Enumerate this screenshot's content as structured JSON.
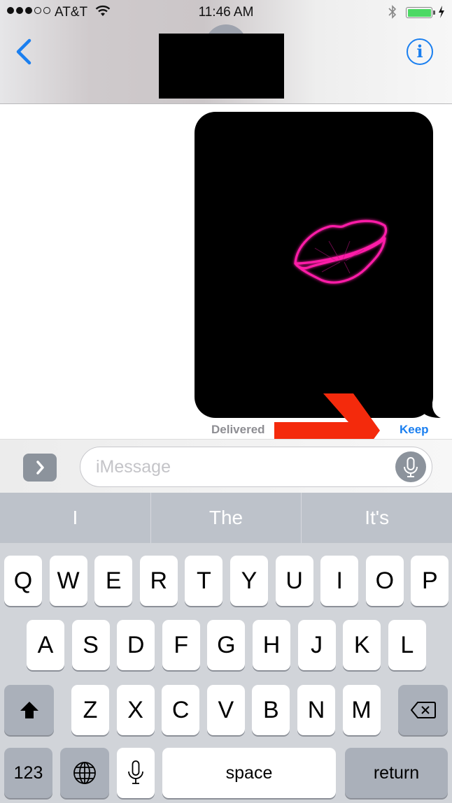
{
  "status_bar": {
    "signal_bars_filled": 3,
    "signal_bars_total": 5,
    "carrier": "AT&T",
    "time": "11:46 AM",
    "battery_level": 1.0,
    "charging": true,
    "icons": [
      "wifi-icon",
      "bluetooth-icon",
      "battery-icon",
      "charging-bolt-icon"
    ]
  },
  "nav": {
    "back_icon": "chevron-left-icon",
    "contact_name_redacted": true,
    "info_label": "i"
  },
  "conversation": {
    "message": {
      "type": "digital-touch-kiss",
      "content_icon": "kiss-lips-icon"
    },
    "delivered_label": "Delivered",
    "keep_label": "Keep",
    "annotation": "red-arrow-pointing-to-keep"
  },
  "input_bar": {
    "expand_icon": "chevron-right-icon",
    "placeholder": "iMessage",
    "value": "",
    "mic_icon": "microphone-icon"
  },
  "keyboard": {
    "predictions": [
      "I",
      "The",
      "It's"
    ],
    "row1": [
      "Q",
      "W",
      "E",
      "R",
      "T",
      "Y",
      "U",
      "I",
      "O",
      "P"
    ],
    "row2": [
      "A",
      "S",
      "D",
      "F",
      "G",
      "H",
      "J",
      "K",
      "L"
    ],
    "row3": [
      "Z",
      "X",
      "C",
      "V",
      "B",
      "N",
      "M"
    ],
    "numbers_label": "123",
    "space_label": "space",
    "return_label": "return"
  },
  "colors": {
    "accent": "#1a7ff0",
    "battery": "#4cd964",
    "annotation_red": "#f42a0c",
    "kiss_pink": "#ff1ea8"
  }
}
